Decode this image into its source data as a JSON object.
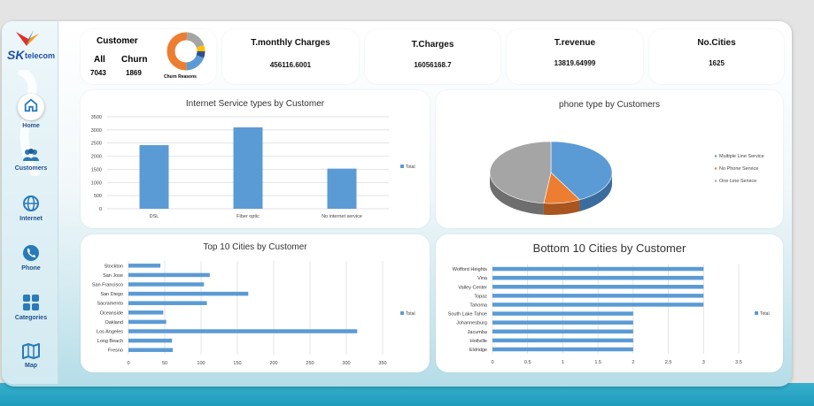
{
  "brand": {
    "logo_sk": "SK",
    "logo_telecom": "telecom"
  },
  "nav": [
    {
      "label": "Home",
      "icon": "home-icon",
      "active": true
    },
    {
      "label": "Customers",
      "icon": "users-icon"
    },
    {
      "label": "Internet",
      "icon": "globe-icon"
    },
    {
      "label": "Phone",
      "icon": "phone-icon"
    },
    {
      "label": "Categories",
      "icon": "grid-icon"
    },
    {
      "label": "Map",
      "icon": "map-icon"
    }
  ],
  "kpis": {
    "customer": {
      "title": "Customer",
      "all_label": "All",
      "all_value": "7043",
      "churn_label": "Churn",
      "churn_value": "1869",
      "donut_caption": "Churn Reasons"
    },
    "monthly": {
      "title": "T.monthly Charges",
      "value": "456116.6001"
    },
    "charges": {
      "title": "T.Charges",
      "value": "16056168.7"
    },
    "revenue": {
      "title": "T.revenue",
      "value": "13819.64999"
    },
    "cities": {
      "title": "No.Cities",
      "value": "1625"
    }
  },
  "colors": {
    "blue": "#5b9bd5",
    "orange": "#ed7d31",
    "gray": "#a5a5a5",
    "yellow": "#ffc000",
    "darkblue": "#2f4e8f"
  },
  "chart_data": [
    {
      "type": "bar",
      "title": "Internet Service types by Customer",
      "categories": [
        "DSL",
        "Fiber optic",
        "No internet service"
      ],
      "series": [
        {
          "name": "Total",
          "values": [
            2421,
            3096,
            1526
          ]
        }
      ],
      "yticks": [
        "0",
        "500",
        "1000",
        "1500",
        "2000",
        "2500",
        "3000",
        "3500"
      ],
      "ylim": [
        0,
        3500
      ],
      "legend": "right",
      "grid": true
    },
    {
      "type": "pie",
      "title": "phone type by Customers",
      "labels": [
        "Multiple Line Service",
        "No Phone Service",
        "One Line Service"
      ],
      "values": [
        2971,
        682,
        3390
      ],
      "legend": "right"
    },
    {
      "type": "bar",
      "orientation": "horizontal",
      "title": "Top 10 Cities by Customer",
      "categories": [
        "Stockton",
        "San Jose",
        "San Francisco",
        "San Diego",
        "Sacramento",
        "Oceanside",
        "Oakland",
        "Los Angeles",
        "Long Beach",
        "Fresno"
      ],
      "series": [
        {
          "name": "Total",
          "values": [
            44,
            112,
            104,
            165,
            108,
            48,
            52,
            315,
            60,
            61
          ]
        }
      ],
      "xticks": [
        "0",
        "50",
        "100",
        "150",
        "200",
        "250",
        "300",
        "350"
      ],
      "xlim": [
        0,
        350
      ],
      "legend": "right",
      "grid": true
    },
    {
      "type": "bar",
      "orientation": "horizontal",
      "title": "Bottom 10 Cities by Customer",
      "categories": [
        "Wofford Heights",
        "Vina",
        "Valley Center",
        "Topaz",
        "Tahoma",
        "South Lake Tahoe",
        "Johannesburg",
        "Jacumba",
        "Holtville",
        "Eldridge"
      ],
      "series": [
        {
          "name": "Total",
          "values": [
            3,
            3,
            3,
            3,
            3,
            2,
            2,
            2,
            2,
            2
          ]
        }
      ],
      "xticks": [
        "0",
        "0.5",
        "1",
        "1.5",
        "2",
        "2.5",
        "3",
        "3.5"
      ],
      "xlim": [
        0,
        3.5
      ],
      "legend": "right",
      "grid": true
    }
  ]
}
